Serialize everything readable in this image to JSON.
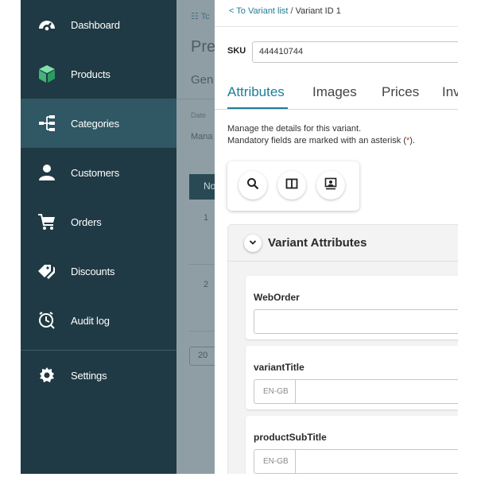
{
  "sidebar": {
    "items": [
      {
        "label": "Dashboard",
        "icon": "dashboard-gauge-icon"
      },
      {
        "label": "Products",
        "icon": "box-icon"
      },
      {
        "label": "Categories",
        "icon": "category-tree-icon"
      },
      {
        "label": "Customers",
        "icon": "user-icon"
      },
      {
        "label": "Orders",
        "icon": "cart-icon"
      },
      {
        "label": "Discounts",
        "icon": "tags-icon"
      },
      {
        "label": "Audit log",
        "icon": "audit-clock-icon"
      },
      {
        "label": "Settings",
        "icon": "gear-icon"
      }
    ],
    "active_index": 2
  },
  "background_page": {
    "breadcrumb": "Tc",
    "title": "Pre",
    "tab": "Gen",
    "date_label": "Date",
    "manage_text": "Mana",
    "button_label": "No",
    "row_1": "1",
    "row_2": "2",
    "page_size": "20"
  },
  "drawer": {
    "breadcrumb": {
      "back_link": "< To Variant list",
      "separator": "/",
      "current": "Variant ID 1"
    },
    "sku": {
      "label": "SKU",
      "value": "444410744"
    },
    "tabs": [
      "Attributes",
      "Images",
      "Prices",
      "Inv"
    ],
    "active_tab": "Attributes",
    "description_line1": "Manage the details for this variant.",
    "description_line2_prefix": "Mandatory fields are marked with an asterisk (",
    "description_asterisk": "*",
    "description_line2_suffix": ").",
    "toolbar_icons": [
      "search-icon",
      "columns-icon",
      "presentation-icon"
    ],
    "section": {
      "title": "Variant Attributes",
      "fields": [
        {
          "label": "WebOrder",
          "type": "text",
          "value": ""
        },
        {
          "label": "variantTitle",
          "type": "localized",
          "lang": "EN-GB",
          "value": ""
        },
        {
          "label": "productSubTitle",
          "type": "localized",
          "lang": "EN-GB",
          "value": ""
        }
      ]
    }
  },
  "colors": {
    "sidebar_bg": "#1f3a44",
    "sidebar_active": "#2f5764",
    "accent": "#1e7d96",
    "asterisk": "#d9342b",
    "overlay": "#8f9ea5"
  }
}
